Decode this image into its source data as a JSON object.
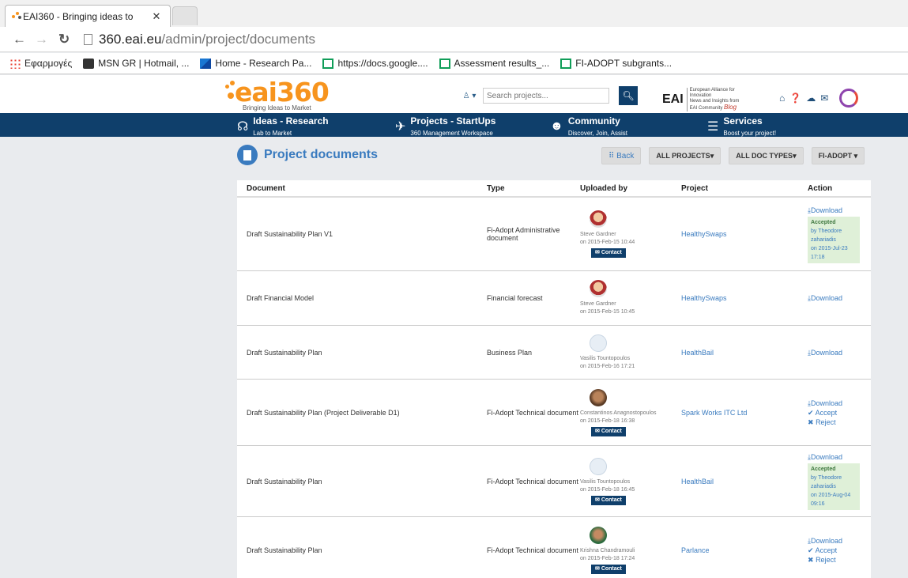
{
  "browser": {
    "tab_title": "EAI360 - Bringing ideas to",
    "tab_close": "✕",
    "url_host": "360.eai.eu",
    "url_path": "/admin/project/documents",
    "bookmarks": [
      {
        "label": "Εφαρμογές",
        "icon": "apps-icon"
      },
      {
        "label": "MSN GR | Hotmail, ...",
        "icon": "msn-icon"
      },
      {
        "label": "Home - Research Pa...",
        "icon": "research-icon"
      },
      {
        "label": "https://docs.google....",
        "icon": "sheets-icon"
      },
      {
        "label": "Assessment results_...",
        "icon": "sheets-icon"
      },
      {
        "label": "FI-ADOPT subgrants...",
        "icon": "sheets-icon"
      }
    ]
  },
  "header": {
    "logo_text": "eai360",
    "logo_tagline": "Bringing Ideas to Market",
    "search_placeholder": "Search projects...",
    "eai_label": "EAI",
    "eai_sub": "European Alliance for Innovation",
    "eai_sub2": "News and Insights from EAI Community",
    "blog_label": "Blog"
  },
  "nav": [
    {
      "title": "Ideas - Research",
      "sub": "Lab to Market",
      "icon": "☊"
    },
    {
      "title": "Projects - StartUps",
      "sub": "360 Management Workspace",
      "icon": "✈"
    },
    {
      "title": "Community",
      "sub": "Discover, Join, Assist",
      "icon": "☻"
    },
    {
      "title": "Services",
      "sub": "Boost your project!",
      "icon": "☰"
    }
  ],
  "page": {
    "title": "Project documents",
    "buttons": {
      "back": "Back",
      "all_projects": "ALL PROJECTS",
      "all_doc_types": "ALL DOC TYPES",
      "fi_adopt": "FI-ADOPT"
    }
  },
  "table": {
    "headers": {
      "document": "Document",
      "type": "Type",
      "uploaded_by": "Uploaded by",
      "project": "Project",
      "action": "Action"
    },
    "labels": {
      "contact": "Contact",
      "download": "Download",
      "accept": "Accept",
      "reject": "Reject",
      "accepted": "Accepted"
    },
    "rows": [
      {
        "document": "Draft Sustainability Plan V1",
        "type": "Fi-Adopt Administrative document",
        "uploader": "Steve Gardner",
        "date": "on 2015-Feb-15 10:44",
        "project": "HealthySwaps",
        "by": "by Theodore zahariadis",
        "on": "on 2015-Jul-23 17:18"
      },
      {
        "document": "Draft Financial Model",
        "type": "Financial forecast",
        "uploader": "Steve Gardner",
        "date": "on 2015-Feb-15 10:45",
        "project": "HealthySwaps"
      },
      {
        "document": "Draft Sustainability Plan",
        "type": "Business Plan",
        "uploader": "Vasilis Tountopoulos",
        "date": "on 2015-Feb-16 17:21",
        "project": "HealthBail"
      },
      {
        "document": "Draft Sustainability Plan (Project Deliverable D1)",
        "type": "Fi-Adopt Technical document",
        "uploader": "Constantinos Anagnostopoulos",
        "date": "on 2015-Feb-18 16:38",
        "project": "Spark Works ITC Ltd"
      },
      {
        "document": "Draft Sustainability Plan",
        "type": "Fi-Adopt Technical document",
        "uploader": "Vasilis Tountopoulos",
        "date": "on 2015-Feb-18 16:45",
        "project": "HealthBail",
        "by": "by Theodore zahariadis",
        "on": "on 2015-Aug-04 09:16"
      },
      {
        "document": "Draft Sustainability Plan",
        "type": "Fi-Adopt Technical document",
        "uploader": "Krishna Chandramouli",
        "date": "on 2015-Feb-18 17:24",
        "project": "Parlance"
      }
    ]
  }
}
